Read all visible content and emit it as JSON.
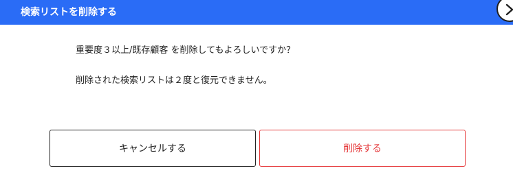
{
  "dialog": {
    "title": "検索リストを削除する",
    "message_confirm": "重要度３以上/既存顧客 を削除してもよろしいですか？",
    "message_warning": "削除された検索リストは２度と復元できません。",
    "cancel_label": "キャンセルする",
    "delete_label": "削除する"
  },
  "icons": {
    "close": "chevron-right-icon"
  },
  "colors": {
    "header": "#2a6cf6",
    "delete": "#e5393b",
    "text": "#222222"
  }
}
